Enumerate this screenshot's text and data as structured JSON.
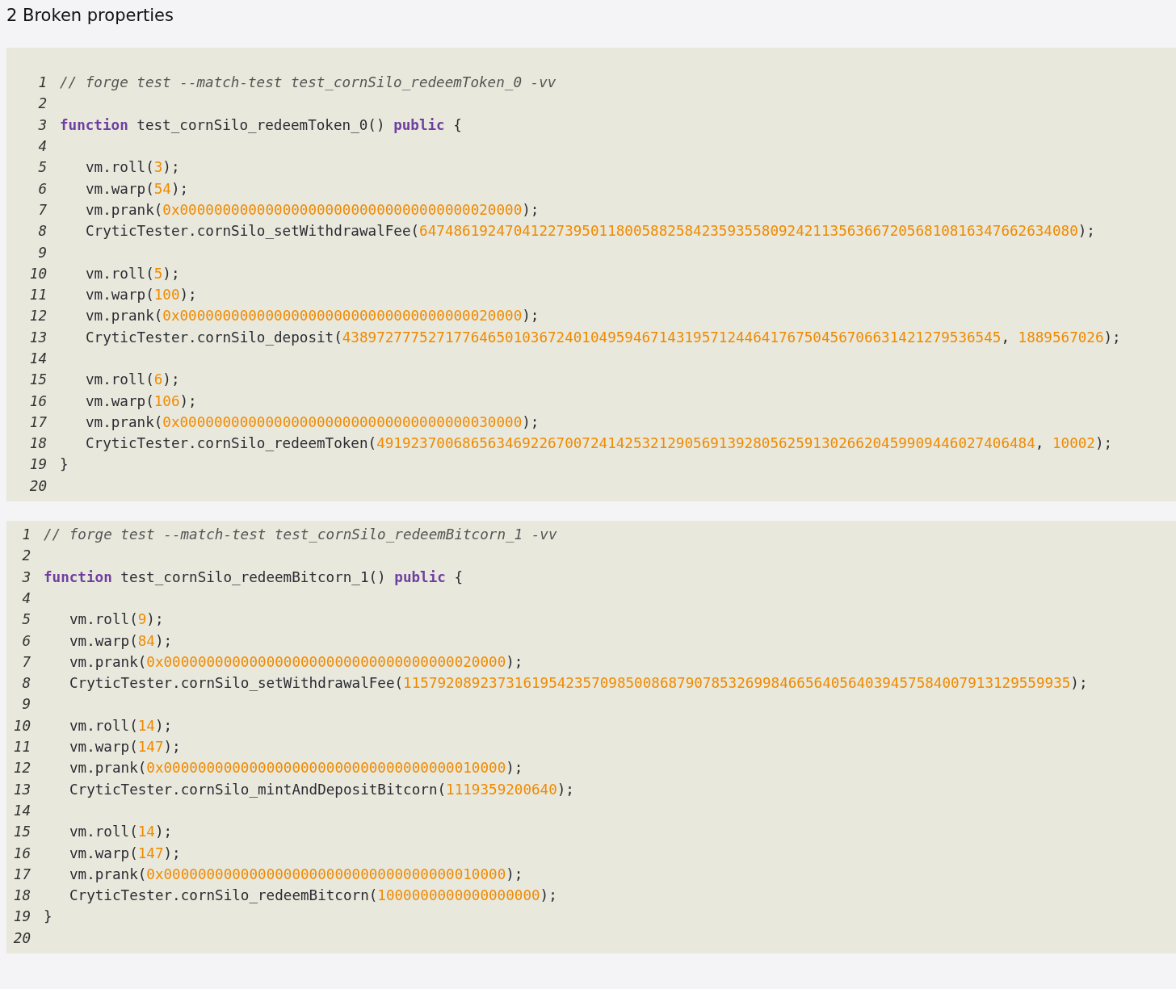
{
  "heading": "2 Broken properties",
  "blocks": [
    {
      "lines": [
        {
          "number": "1",
          "tokens": [
            {
              "kind": "comment",
              "text": "// forge test --match-test test_cornSilo_redeemToken_0 -vv"
            }
          ]
        },
        {
          "number": "2"
        },
        {
          "number": "3",
          "tokens": [
            {
              "kind": "keyword",
              "text": "function"
            },
            {
              "kind": "plain",
              "text": " test_cornSilo_redeemToken_0() "
            },
            {
              "kind": "keyword",
              "text": "public"
            },
            {
              "kind": "plain",
              "text": " {"
            }
          ],
          "children": [
            {
              "number": "4"
            },
            {
              "number": "5",
              "tokens": [
                {
                  "kind": "plain",
                  "text": "vm.roll("
                },
                {
                  "kind": "number",
                  "text": "3"
                },
                {
                  "kind": "plain",
                  "text": ");"
                }
              ]
            },
            {
              "number": "6",
              "tokens": [
                {
                  "kind": "plain",
                  "text": "vm.warp("
                },
                {
                  "kind": "number",
                  "text": "54"
                },
                {
                  "kind": "plain",
                  "text": ");"
                }
              ]
            },
            {
              "number": "7",
              "tokens": [
                {
                  "kind": "plain",
                  "text": "vm.prank("
                },
                {
                  "kind": "number",
                  "text": "0x0000000000000000000000000000000000020000"
                },
                {
                  "kind": "plain",
                  "text": ");"
                }
              ]
            },
            {
              "number": "8",
              "tokens": [
                {
                  "kind": "plain",
                  "text": "CryticTester.cornSilo_setWithdrawalFee("
                },
                {
                  "kind": "number",
                  "text": "64748619247041227395011800588258423593558092421135636672056810816347662634080"
                },
                {
                  "kind": "plain",
                  "text": ");"
                }
              ]
            },
            {
              "number": "9"
            },
            {
              "number": "10",
              "tokens": [
                {
                  "kind": "plain",
                  "text": "vm.roll("
                },
                {
                  "kind": "number",
                  "text": "5"
                },
                {
                  "kind": "plain",
                  "text": ");"
                }
              ]
            },
            {
              "number": "11",
              "tokens": [
                {
                  "kind": "plain",
                  "text": "vm.warp("
                },
                {
                  "kind": "number",
                  "text": "100"
                },
                {
                  "kind": "plain",
                  "text": ");"
                }
              ]
            },
            {
              "number": "12",
              "tokens": [
                {
                  "kind": "plain",
                  "text": "vm.prank("
                },
                {
                  "kind": "number",
                  "text": "0x0000000000000000000000000000000000020000"
                },
                {
                  "kind": "plain",
                  "text": ");"
                }
              ]
            },
            {
              "number": "13",
              "tokens": [
                {
                  "kind": "plain",
                  "text": "CryticTester.cornSilo_deposit("
                },
                {
                  "kind": "number",
                  "text": "43897277752717764650103672401049594671431957124464176750456706631421279536545"
                },
                {
                  "kind": "plain",
                  "text": ", "
                },
                {
                  "kind": "number",
                  "text": "1889567026"
                },
                {
                  "kind": "plain",
                  "text": ");"
                }
              ]
            },
            {
              "number": "14"
            },
            {
              "number": "15",
              "tokens": [
                {
                  "kind": "plain",
                  "text": "vm.roll("
                },
                {
                  "kind": "number",
                  "text": "6"
                },
                {
                  "kind": "plain",
                  "text": ");"
                }
              ]
            },
            {
              "number": "16",
              "tokens": [
                {
                  "kind": "plain",
                  "text": "vm.warp("
                },
                {
                  "kind": "number",
                  "text": "106"
                },
                {
                  "kind": "plain",
                  "text": ");"
                }
              ]
            },
            {
              "number": "17",
              "tokens": [
                {
                  "kind": "plain",
                  "text": "vm.prank("
                },
                {
                  "kind": "number",
                  "text": "0x0000000000000000000000000000000000030000"
                },
                {
                  "kind": "plain",
                  "text": ");"
                }
              ]
            },
            {
              "number": "18",
              "tokens": [
                {
                  "kind": "plain",
                  "text": "CryticTester.cornSilo_redeemToken("
                },
                {
                  "kind": "number",
                  "text": "49192370068656346922670072414253212905691392805625913026620459909446027406484"
                },
                {
                  "kind": "plain",
                  "text": ", "
                },
                {
                  "kind": "number",
                  "text": "10002"
                },
                {
                  "kind": "plain",
                  "text": ");"
                }
              ]
            }
          ]
        },
        {
          "number": "19",
          "tokens": [
            {
              "kind": "plain",
              "text": "}"
            }
          ]
        },
        {
          "number": "20"
        }
      ]
    },
    {
      "lines": [
        {
          "number": "1",
          "tokens": [
            {
              "kind": "comment",
              "text": "// forge test --match-test test_cornSilo_redeemBitcorn_1 -vv"
            }
          ]
        },
        {
          "number": "2"
        },
        {
          "number": "3",
          "tokens": [
            {
              "kind": "keyword",
              "text": "function"
            },
            {
              "kind": "plain",
              "text": " test_cornSilo_redeemBitcorn_1() "
            },
            {
              "kind": "keyword",
              "text": "public"
            },
            {
              "kind": "plain",
              "text": " {"
            }
          ],
          "children": [
            {
              "number": "4"
            },
            {
              "number": "5",
              "tokens": [
                {
                  "kind": "plain",
                  "text": "vm.roll("
                },
                {
                  "kind": "number",
                  "text": "9"
                },
                {
                  "kind": "plain",
                  "text": ");"
                }
              ]
            },
            {
              "number": "6",
              "tokens": [
                {
                  "kind": "plain",
                  "text": "vm.warp("
                },
                {
                  "kind": "number",
                  "text": "84"
                },
                {
                  "kind": "plain",
                  "text": ");"
                }
              ]
            },
            {
              "number": "7",
              "tokens": [
                {
                  "kind": "plain",
                  "text": "vm.prank("
                },
                {
                  "kind": "number",
                  "text": "0x0000000000000000000000000000000000020000"
                },
                {
                  "kind": "plain",
                  "text": ");"
                }
              ]
            },
            {
              "number": "8",
              "tokens": [
                {
                  "kind": "plain",
                  "text": "CryticTester.cornSilo_setWithdrawalFee("
                },
                {
                  "kind": "number",
                  "text": "115792089237316195423570985008687907853269984665640564039457584007913129559935"
                },
                {
                  "kind": "plain",
                  "text": ");"
                }
              ]
            },
            {
              "number": "9"
            },
            {
              "number": "10",
              "tokens": [
                {
                  "kind": "plain",
                  "text": "vm.roll("
                },
                {
                  "kind": "number",
                  "text": "14"
                },
                {
                  "kind": "plain",
                  "text": ");"
                }
              ]
            },
            {
              "number": "11",
              "tokens": [
                {
                  "kind": "plain",
                  "text": "vm.warp("
                },
                {
                  "kind": "number",
                  "text": "147"
                },
                {
                  "kind": "plain",
                  "text": ");"
                }
              ]
            },
            {
              "number": "12",
              "tokens": [
                {
                  "kind": "plain",
                  "text": "vm.prank("
                },
                {
                  "kind": "number",
                  "text": "0x0000000000000000000000000000000000010000"
                },
                {
                  "kind": "plain",
                  "text": ");"
                }
              ]
            },
            {
              "number": "13",
              "tokens": [
                {
                  "kind": "plain",
                  "text": "CryticTester.cornSilo_mintAndDepositBitcorn("
                },
                {
                  "kind": "number",
                  "text": "1119359200640"
                },
                {
                  "kind": "plain",
                  "text": ");"
                }
              ]
            },
            {
              "number": "14"
            },
            {
              "number": "15",
              "tokens": [
                {
                  "kind": "plain",
                  "text": "vm.roll("
                },
                {
                  "kind": "number",
                  "text": "14"
                },
                {
                  "kind": "plain",
                  "text": ");"
                }
              ]
            },
            {
              "number": "16",
              "tokens": [
                {
                  "kind": "plain",
                  "text": "vm.warp("
                },
                {
                  "kind": "number",
                  "text": "147"
                },
                {
                  "kind": "plain",
                  "text": ");"
                }
              ]
            },
            {
              "number": "17",
              "tokens": [
                {
                  "kind": "plain",
                  "text": "vm.prank("
                },
                {
                  "kind": "number",
                  "text": "0x0000000000000000000000000000000000010000"
                },
                {
                  "kind": "plain",
                  "text": ");"
                }
              ]
            },
            {
              "number": "18",
              "tokens": [
                {
                  "kind": "plain",
                  "text": "CryticTester.cornSilo_redeemBitcorn("
                },
                {
                  "kind": "number",
                  "text": "1000000000000000000"
                },
                {
                  "kind": "plain",
                  "text": ");"
                }
              ]
            }
          ]
        },
        {
          "number": "19",
          "tokens": [
            {
              "kind": "plain",
              "text": "}"
            }
          ]
        },
        {
          "number": "20"
        }
      ]
    }
  ]
}
